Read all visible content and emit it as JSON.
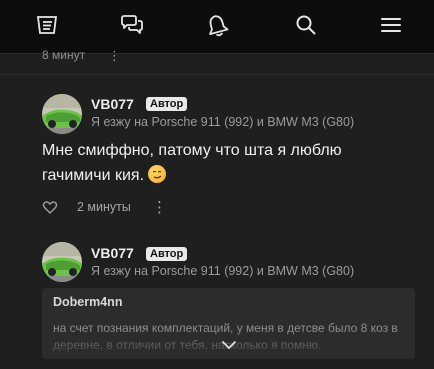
{
  "nav": {
    "items": [
      {
        "name": "feed",
        "icon": "feed-icon"
      },
      {
        "name": "chats",
        "icon": "chat-bubbles-icon"
      },
      {
        "name": "notifications",
        "icon": "bell-icon"
      },
      {
        "name": "search",
        "icon": "search-icon"
      },
      {
        "name": "menu",
        "icon": "hamburger-menu-icon"
      }
    ]
  },
  "previous_comment": {
    "time": "8 минут",
    "more": "⋮"
  },
  "comments": [
    {
      "author": "VB077",
      "badge": "Автор",
      "cars": "Я езжу на Porsche 911 (992) и BMW M3 (G80)",
      "text": "Мне смиффно, патому что шта я люблю гачимичи кия.",
      "emoji": "smirking-face-emoji",
      "time": "2 минуты",
      "more": "⋮"
    },
    {
      "author": "VB077",
      "badge": "Автор",
      "cars": "Я езжу на Porsche 911 (992) и BMW M3 (G80)",
      "quote": {
        "author": "Doberm4nn",
        "text": "на счет познания комплектаций, у меня в детсве было 8 коз в деревне, в отличии от тебя, насколько я помню."
      }
    }
  ],
  "colors": {
    "topbar": "#0d0d0d",
    "background": "#1f1f1f",
    "badge_bg": "#e9e9e9",
    "avatar_green": "#6cc24a"
  }
}
